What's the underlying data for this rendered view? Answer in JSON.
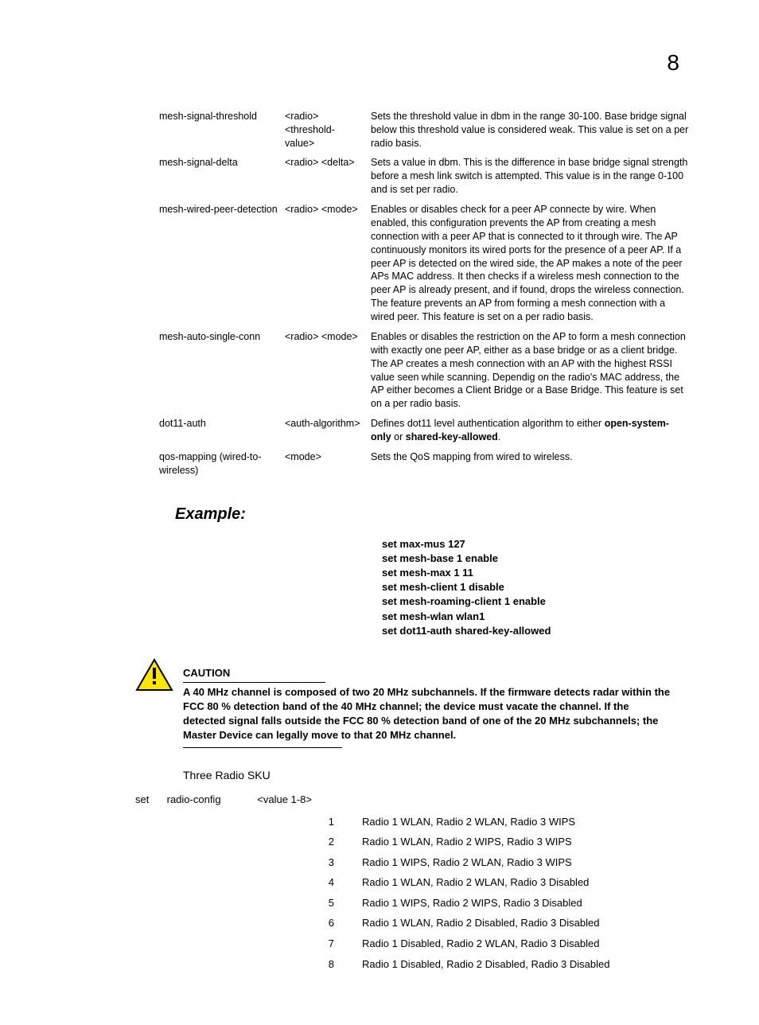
{
  "page_number": "8",
  "params": [
    {
      "name": "mesh-signal-threshold",
      "args": "<radio> <threshold-value>",
      "desc": "Sets the threshold value in dbm in the range 30-100. Base bridge signal below this threshold value is considered weak. This value is set on a per radio basis."
    },
    {
      "name": "mesh-signal-delta",
      "args": "<radio> <delta>",
      "desc": "Sets a value in dbm. This is the difference in base bridge signal strength before a mesh link switch is attempted. This value is in the range 0-100 and is set per radio."
    },
    {
      "name": "mesh-wired-peer-detection",
      "args": "<radio> <mode>",
      "desc": "Enables or disables check for a peer AP connecte by wire. When enabled, this configuration prevents the AP from creating a mesh connection with a peer AP that is connected to it through wire. The AP continuously monitors its wired ports for the presence of a peer AP. If a peer AP is detected on the wired side, the AP makes a note of the peer APs MAC address. It then checks if a wireless mesh connection to the peer AP is already present, and if found, drops the wireless connection. The feature prevents an AP from forming a mesh connection with a wired peer. This feature is set on a per radio basis."
    },
    {
      "name": "mesh-auto-single-conn",
      "args": "<radio> <mode>",
      "desc": "Enables or disables the restriction on the AP to form a mesh connection with exactly one peer AP, either as a base bridge or as a client bridge. The AP creates a mesh connection with an AP with the highest RSSI value seen while scanning. Dependig on the radio's MAC address, the AP either becomes a Client Bridge or a Base Bridge. This feature is set on a per radio basis."
    },
    {
      "name": "dot11-auth",
      "args": "<auth-algorithm>",
      "desc_prefix": "Defines dot11 level authentication algorithm to either ",
      "desc_bold1": "open-system-only",
      "desc_mid": " or ",
      "desc_bold2": "shared-key-allowed",
      "desc_suffix": "."
    },
    {
      "name": "qos-mapping (wired-to-wireless)",
      "args": "<mode>",
      "desc": "Sets the QoS mapping from wired to wireless."
    }
  ],
  "example_heading": "Example:",
  "example_lines": [
    "set max-mus 127",
    "set mesh-base 1 enable",
    "set mesh-max 1 11",
    "set mesh-client 1 disable",
    "set mesh-roaming-client 1 enable",
    "set mesh-wlan wlan1",
    "set dot11-auth shared-key-allowed"
  ],
  "caution_label": "CAUTION",
  "caution_text": "A 40 MHz channel is composed of two 20 MHz subchannels. If the firmware detects radar within the FCC 80 % detection band of the 40 MHz channel; the device must vacate the channel. If the detected signal falls outside the FCC 80 % detection band of one of the 20 MHz subchannels; the Master Device can legally move to that 20 MHz channel.",
  "sku_heading": "Three Radio SKU",
  "sku_set": "set",
  "sku_param": "radio-config",
  "sku_val": "<value 1-8>",
  "radio_configs": [
    {
      "num": "1",
      "desc": "Radio 1 WLAN, Radio 2 WLAN, Radio 3 WIPS"
    },
    {
      "num": "2",
      "desc": "Radio 1 WLAN, Radio 2 WIPS, Radio 3 WIPS"
    },
    {
      "num": "3",
      "desc": "Radio 1 WIPS, Radio 2 WLAN, Radio 3 WIPS"
    },
    {
      "num": "4",
      "desc": "Radio 1 WLAN, Radio 2 WLAN, Radio 3 Disabled"
    },
    {
      "num": "5",
      "desc": "Radio 1 WIPS, Radio 2 WIPS, Radio 3 Disabled"
    },
    {
      "num": "6",
      "desc": "Radio 1 WLAN, Radio 2 Disabled, Radio 3 Disabled"
    },
    {
      "num": "7",
      "desc": "Radio 1 Disabled, Radio 2 WLAN, Radio 3 Disabled"
    },
    {
      "num": "8",
      "desc": "Radio 1 Disabled, Radio 2 Disabled, Radio 3 Disabled"
    }
  ]
}
